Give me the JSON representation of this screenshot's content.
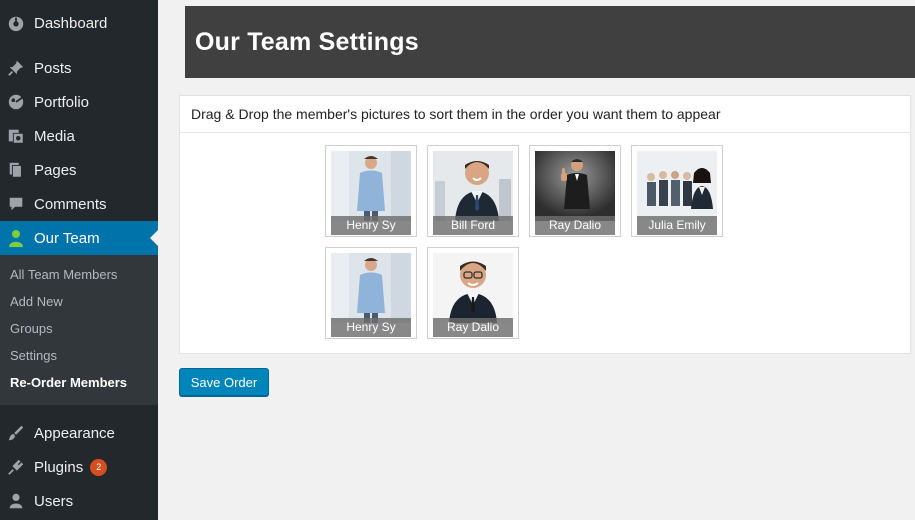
{
  "sidebar": {
    "top_items": [
      {
        "label": "Dashboard",
        "icon": "dashboard-icon"
      },
      {
        "label": "Posts",
        "icon": "pushpin-icon"
      },
      {
        "label": "Portfolio",
        "icon": "portfolio-icon"
      },
      {
        "label": "Media",
        "icon": "media-icon"
      },
      {
        "label": "Pages",
        "icon": "pages-icon"
      },
      {
        "label": "Comments",
        "icon": "comment-icon"
      },
      {
        "label": "Our Team",
        "icon": "person-icon"
      }
    ],
    "submenu": [
      {
        "label": "All Team Members"
      },
      {
        "label": "Add New"
      },
      {
        "label": "Groups"
      },
      {
        "label": "Settings"
      },
      {
        "label": "Re-Order Members"
      }
    ],
    "bottom_items": [
      {
        "label": "Appearance",
        "icon": "paintbrush-icon"
      },
      {
        "label": "Plugins",
        "icon": "plugin-icon",
        "badge": "2"
      },
      {
        "label": "Users",
        "icon": "user-icon"
      }
    ]
  },
  "page": {
    "title": "Our Team Settings",
    "instructions": "Drag & Drop the member's pictures to sort them in the order you want them to appear"
  },
  "members": [
    {
      "name": "Henry Sy"
    },
    {
      "name": "Bill Ford"
    },
    {
      "name": "Ray Dalio"
    },
    {
      "name": "Julia Emily"
    },
    {
      "name": "Henry Sy"
    },
    {
      "name": "Ray Dalio"
    }
  ],
  "actions": {
    "save_label": "Save Order"
  },
  "colors": {
    "sidebar_bg": "#23282d",
    "submenu_bg": "#32373c",
    "current_menu": "#0073aa",
    "header_bg": "#404040",
    "button_blue": "#0085ba",
    "badge": "#d54e21"
  }
}
